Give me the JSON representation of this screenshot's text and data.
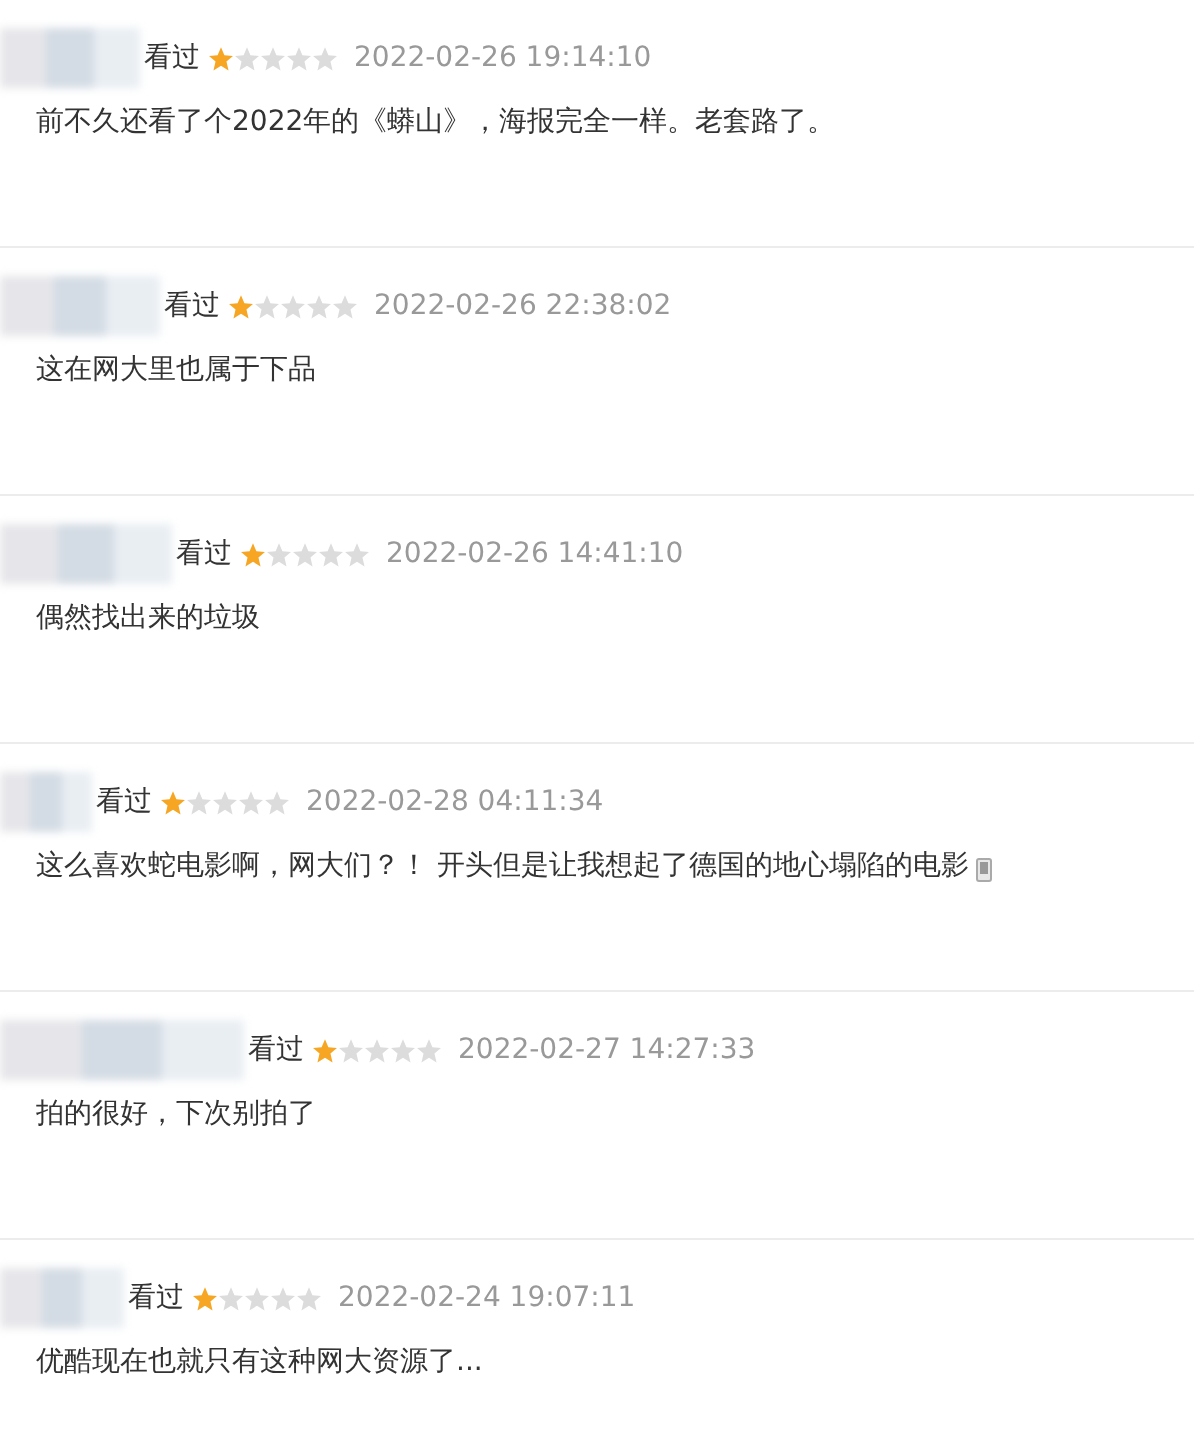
{
  "comments": [
    {
      "status": "看过",
      "stars": 1,
      "time": "2022-02-26 19:14:10",
      "text": "前不久还看了个2022年的《蟒山》，海报完全一样。老套路了。",
      "mobile": false
    },
    {
      "status": "看过",
      "stars": 1,
      "time": "2022-02-26 22:38:02",
      "text": "这在网大里也属于下品",
      "mobile": false
    },
    {
      "status": "看过",
      "stars": 1,
      "time": "2022-02-26 14:41:10",
      "text": "偶然找出来的垃圾",
      "mobile": false
    },
    {
      "status": "看过",
      "stars": 1,
      "time": "2022-02-28 04:11:34",
      "text": "这么喜欢蛇电影啊，网大们？！  开头但是让我想起了德国的地心塌陷的电影",
      "mobile": true
    },
    {
      "status": "看过",
      "stars": 1,
      "time": "2022-02-27 14:27:33",
      "text": "拍的很好，下次别拍了",
      "mobile": false
    },
    {
      "status": "看过",
      "stars": 1,
      "time": "2022-02-24 19:07:11",
      "text": "优酷现在也就只有这种网大资源了...",
      "mobile": false
    }
  ]
}
